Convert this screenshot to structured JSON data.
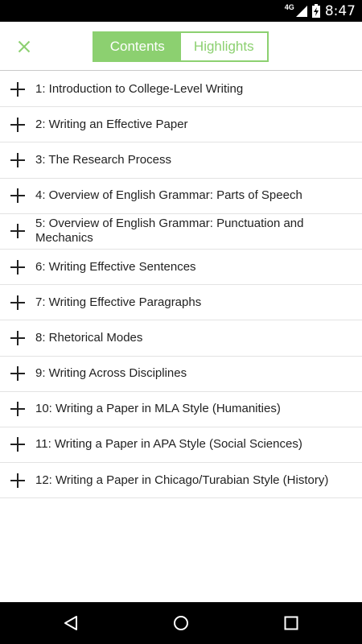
{
  "status_bar": {
    "network": "4G",
    "time": "8:47"
  },
  "header": {
    "tabs": [
      {
        "label": "Contents",
        "active": true
      },
      {
        "label": "Highlights",
        "active": false
      }
    ],
    "accent_color": "#8cd070"
  },
  "contents": {
    "items": [
      {
        "label": "1: Introduction to College-Level Writing"
      },
      {
        "label": "2: Writing an Effective Paper"
      },
      {
        "label": "3: The Research Process"
      },
      {
        "label": "4: Overview of English Grammar: Parts of Speech"
      },
      {
        "label": "5: Overview of English Grammar: Punctuation and Mechanics"
      },
      {
        "label": "6: Writing Effective Sentences"
      },
      {
        "label": "7: Writing Effective Paragraphs"
      },
      {
        "label": "8: Rhetorical Modes"
      },
      {
        "label": "9: Writing Across Disciplines"
      },
      {
        "label": "10: Writing a Paper in MLA Style (Humanities)"
      },
      {
        "label": "11: Writing a Paper in APA Style (Social Sciences)"
      },
      {
        "label": "12: Writing a Paper in Chicago/Turabian Style (History)"
      }
    ],
    "expand_icon": "plus-icon"
  },
  "nav_bar": {
    "icons": [
      "back-icon",
      "home-icon",
      "recents-icon"
    ]
  }
}
